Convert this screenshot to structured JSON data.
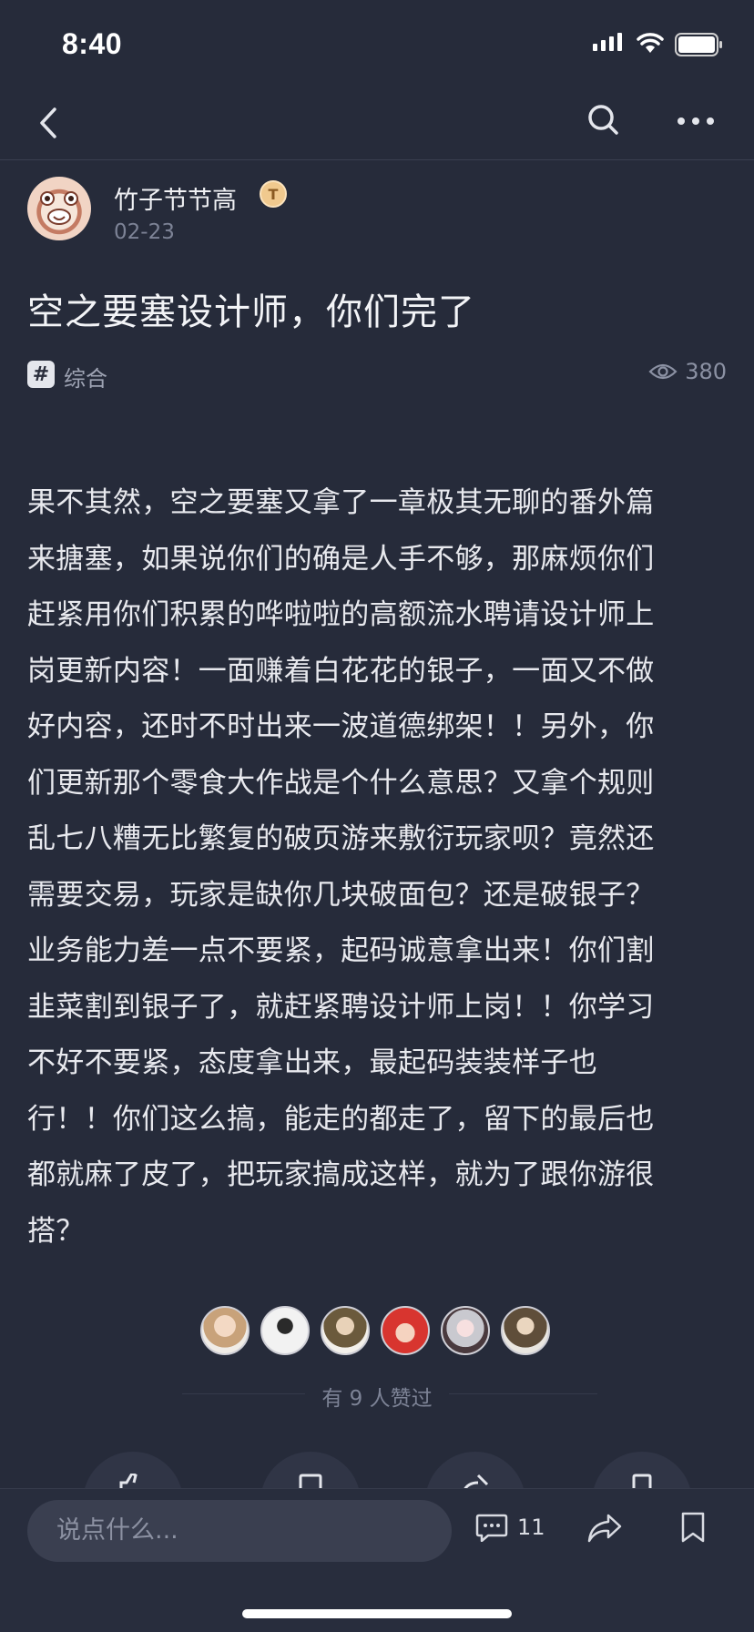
{
  "status_bar": {
    "time": "8:40"
  },
  "nav": {
    "back_icon": "chevron-left-icon",
    "search_icon": "search-icon",
    "more_icon": "more-horizontal-icon"
  },
  "post": {
    "author": {
      "name": "竹子节节高",
      "badge": "T",
      "date": "02-23"
    },
    "title": "空之要塞设计师，你们完了",
    "tag": "综合",
    "views": "380",
    "body_lines": [
      "果不其然，空之要塞又拿了一章极其无聊的番外篇",
      "来搪塞，如果说你们的确是人手不够，那麻烦你们",
      "赶紧用你们积累的哗啦啦的高额流水聘请设计师上",
      "岗更新内容！一面赚着白花花的银子，一面又不做",
      "好内容，还时不时出来一波道德绑架！！另外，你",
      "们更新那个零食大作战是个什么意思？又拿个规则",
      "乱七八糟无比繁复的破页游来敷衍玩家呗？竟然还",
      "需要交易，玩家是缺你几块破面包？还是破银子？",
      "业务能力差一点不要紧，起码诚意拿出来！你们割",
      "韭菜割到银子了，就赶紧聘设计师上岗！！你学习",
      "不好不要紧，态度拿出来，最起码装装样子也",
      "行！！你们这么搞，能走的都走了，留下的最后也",
      "都就麻了皮了，把玩家搞成这样，就为了跟你游很",
      "搭？"
    ],
    "likes_text": "有 9 人赞过",
    "like_count_partial": "9"
  },
  "bottom_bar": {
    "comment_placeholder": "说点什么...",
    "comment_count": "11"
  },
  "colors": {
    "background": "#262b3a",
    "bottom_bar": "#282d3d",
    "input": "#3a3f50",
    "text": "#e8e9ee",
    "muted": "#7d8396"
  }
}
